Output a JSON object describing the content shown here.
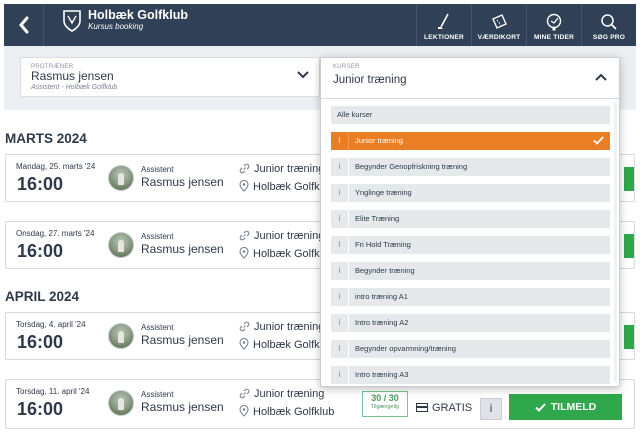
{
  "header": {
    "club_name": "Holbæk Golfklub",
    "subtitle": "Kursus booking",
    "nav": [
      {
        "label": "LEKTIONER",
        "icon": "golf-club-icon"
      },
      {
        "label": "VÆRDIKORT",
        "icon": "ticket-icon"
      },
      {
        "label": "MINE TIDER",
        "icon": "golf-ball-icon"
      },
      {
        "label": "SØG PRO",
        "icon": "search-icon"
      }
    ]
  },
  "filters": {
    "trainer_caption": "PROTRÆNER",
    "trainer_name": "Rasmus jensen",
    "trainer_sub": "Assistent - Holbæk Golfklub",
    "course_caption": "KURSER",
    "course_value": "Junior træning"
  },
  "dropdown": {
    "all_label": "Alle kurser",
    "info_glyph": "i",
    "options": [
      {
        "label": "Junior træning",
        "selected": true
      },
      {
        "label": "Begynder Genopfriskning træning",
        "selected": false
      },
      {
        "label": "Ynglinge træning",
        "selected": false
      },
      {
        "label": "Elite Træning",
        "selected": false
      },
      {
        "label": "Fri Hold Træning",
        "selected": false
      },
      {
        "label": "Begynder træning",
        "selected": false
      },
      {
        "label": "intro træning A1",
        "selected": false
      },
      {
        "label": "Intro træning A2",
        "selected": false
      },
      {
        "label": "Begynder opvarmning/træning",
        "selected": false
      },
      {
        "label": "Intro træning A3",
        "selected": false
      }
    ]
  },
  "months": [
    {
      "label": "MARTS 2024"
    },
    {
      "label": "APRIL 2024"
    }
  ],
  "sessions": [
    {
      "date": "Mandag, 25. marts '24",
      "time": "16:00",
      "role": "Assistent",
      "trainer": "Rasmus jensen",
      "course": "Junior træning",
      "location": "Holbæk Golfklub"
    },
    {
      "date": "Onsdag, 27. marts '24",
      "time": "16:00",
      "role": "Assistent",
      "trainer": "Rasmus jensen",
      "course": "Junior træning",
      "location": "Holbæk Golfklub"
    },
    {
      "date": "Torsdag, 4. april '24",
      "time": "16:00",
      "role": "Assistent",
      "trainer": "Rasmus jensen",
      "course": "Junior træning",
      "location": "Holbæk Golfklub"
    },
    {
      "date": "Torsdag, 11. april '24",
      "time": "16:00",
      "role": "Assistent",
      "trainer": "Rasmus jensen",
      "course": "Junior træning",
      "location": "Holbæk Golfklub",
      "capacity": "30 / 30",
      "capacity_label": "Tilgængelig",
      "price": "GRATIS",
      "info": "i",
      "signup_label": "TILMELD"
    }
  ],
  "colors": {
    "navy": "#2f4057",
    "orange": "#e97e24",
    "green": "#2ea84a"
  }
}
